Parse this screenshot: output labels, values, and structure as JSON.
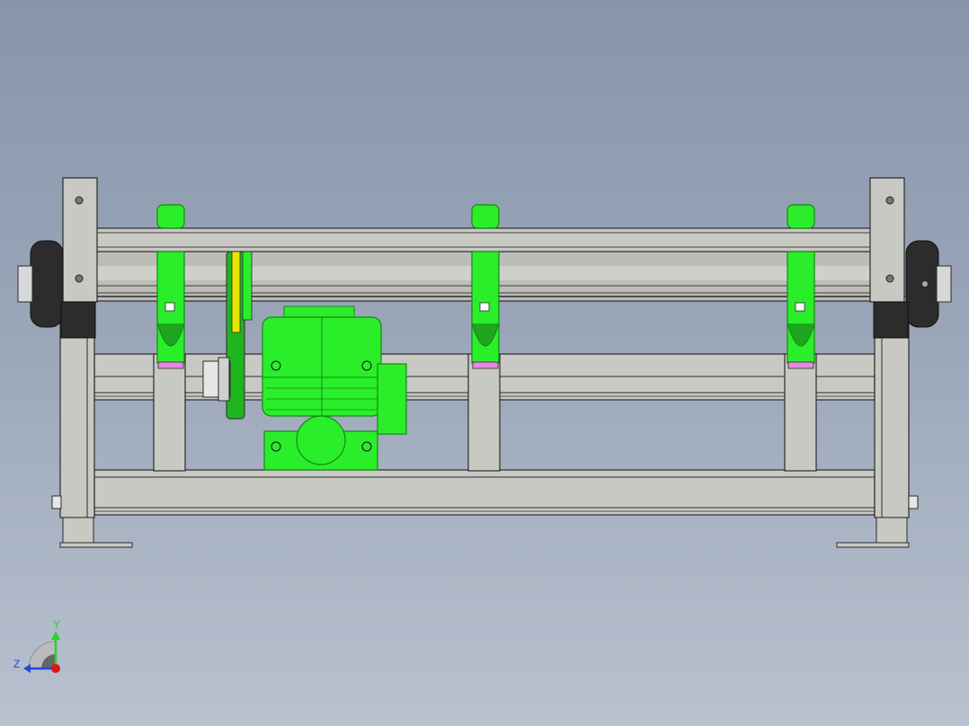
{
  "viewport": {
    "background_top": "#8796ac",
    "background_bottom": "#b8c1cf"
  },
  "model": {
    "frame_color": "#c9c9c4",
    "frame_edge": "#2b2b2b",
    "roller_color": "#bdbdb8",
    "part_green": "#2bee2b",
    "part_green_dark": "#128a12",
    "pulley_yellow": "#e7e600",
    "bearing_dark": "#2c2c2c",
    "pad_pink": "#e58be0"
  },
  "triad": {
    "y_label": "Y",
    "z_label": "Z",
    "y_color": "#2ad12a",
    "z_color": "#2547d6",
    "origin_color": "#e01515"
  }
}
